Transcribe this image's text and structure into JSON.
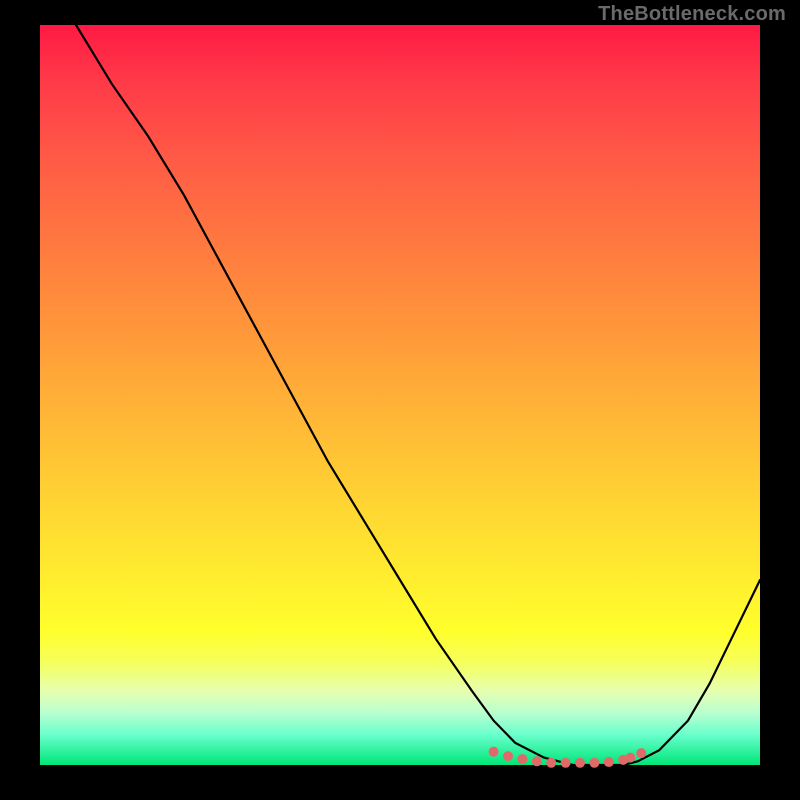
{
  "watermark": "TheBottleneck.com",
  "chart_data": {
    "type": "line",
    "title": "",
    "xlabel": "",
    "ylabel": "",
    "xlim": [
      0,
      100
    ],
    "ylim": [
      0,
      100
    ],
    "series": [
      {
        "name": "curve",
        "color": "#000000",
        "x": [
          5,
          10,
          15,
          20,
          25,
          30,
          35,
          40,
          45,
          50,
          55,
          60,
          63,
          66,
          70,
          74,
          78,
          81,
          83,
          86,
          90,
          93,
          96,
          100
        ],
        "y": [
          100,
          92,
          85,
          77,
          68,
          59,
          50,
          41,
          33,
          25,
          17,
          10,
          6,
          3,
          1,
          0,
          0,
          0,
          0.5,
          2,
          6,
          11,
          17,
          25
        ]
      }
    ],
    "valley_markers": {
      "color": "#e06a6a",
      "points": [
        {
          "x": 63,
          "y": 1.8
        },
        {
          "x": 65,
          "y": 1.2
        },
        {
          "x": 67,
          "y": 0.8
        },
        {
          "x": 69,
          "y": 0.5
        },
        {
          "x": 71,
          "y": 0.3
        },
        {
          "x": 73,
          "y": 0.3
        },
        {
          "x": 75,
          "y": 0.3
        },
        {
          "x": 77,
          "y": 0.3
        },
        {
          "x": 79,
          "y": 0.4
        },
        {
          "x": 81,
          "y": 0.7
        },
        {
          "x": 82,
          "y": 1.0
        },
        {
          "x": 83.5,
          "y": 1.6
        }
      ]
    },
    "gradient_stops": [
      {
        "pos": 0.0,
        "color": "#ff1a44"
      },
      {
        "pos": 0.5,
        "color": "#ffbb33"
      },
      {
        "pos": 0.82,
        "color": "#ffff2c"
      },
      {
        "pos": 1.0,
        "color": "#00e676"
      }
    ]
  }
}
